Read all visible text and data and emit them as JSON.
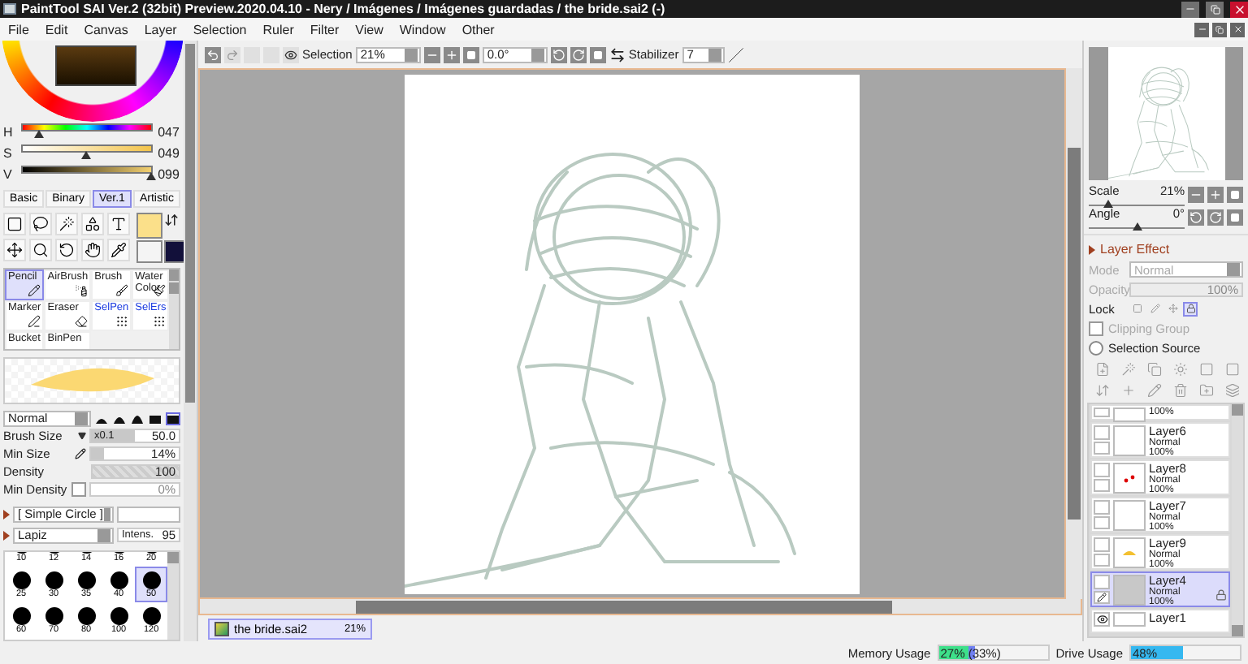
{
  "window": {
    "title": "PaintTool SAI Ver.2 (32bit) Preview.2020.04.10 - Nery / Imágenes / Imágenes guardadas / the bride.sai2 (-)"
  },
  "menu": [
    "File",
    "Edit",
    "Canvas",
    "Layer",
    "Selection",
    "Ruler",
    "Filter",
    "View",
    "Window",
    "Other"
  ],
  "color_sliders": [
    {
      "label": "H",
      "value": "047",
      "level": 0.13,
      "kind": "hue"
    },
    {
      "label": "S",
      "value": "049",
      "level": 0.49,
      "kind": "saturation"
    },
    {
      "label": "V",
      "value": "099",
      "level": 0.99,
      "kind": "value"
    }
  ],
  "palette_tabs": [
    {
      "label": "Basic",
      "selected": false
    },
    {
      "label": "Binary",
      "selected": false
    },
    {
      "label": "Ver.1",
      "selected": true
    },
    {
      "label": "Artistic",
      "selected": false
    }
  ],
  "brushes": [
    {
      "label": "Pencil",
      "kind": "paint",
      "selected": true
    },
    {
      "label": "AirBrush",
      "kind": "paint",
      "selected": false
    },
    {
      "label": "Brush",
      "kind": "paint",
      "selected": false
    },
    {
      "label": "Water Color",
      "kind": "paint",
      "selected": false
    },
    {
      "label": "Marker",
      "kind": "paint",
      "selected": false
    },
    {
      "label": "Eraser",
      "kind": "paint",
      "selected": false
    },
    {
      "label": "SelPen",
      "kind": "selection",
      "selected": false
    },
    {
      "label": "SelErs",
      "kind": "selection",
      "selected": false
    },
    {
      "label": "Bucket",
      "kind": "paint",
      "selected": false
    },
    {
      "label": "BinPen",
      "kind": "paint",
      "selected": false
    }
  ],
  "brush_settings": {
    "blend_mode": "Normal",
    "size_label": "Brush Size",
    "size_multiplier": "x0.1",
    "size": "50.0",
    "size_level": {
      "level": 0.5
    },
    "min_size_label": "Min Size",
    "min_size": "14%",
    "min_size_level": {
      "level": 0.14
    },
    "density_label": "Density",
    "density": "100",
    "density_level": {
      "level": 1
    },
    "min_density_label": "Min Density",
    "min_density": "0%",
    "min_density_checked": false,
    "shape": "[ Simple Circle ]",
    "texture": "Lapiz",
    "intensity_label": "Intens.",
    "intensity": "95"
  },
  "brush_sizes": [
    {
      "label": "10",
      "selected": false
    },
    {
      "label": "12",
      "selected": false
    },
    {
      "label": "14",
      "selected": false
    },
    {
      "label": "16",
      "selected": false
    },
    {
      "label": "20",
      "selected": false
    },
    {
      "label": "25",
      "selected": false
    },
    {
      "label": "30",
      "selected": false
    },
    {
      "label": "35",
      "selected": false
    },
    {
      "label": "40",
      "selected": false
    },
    {
      "label": "50",
      "selected": true
    },
    {
      "label": "60",
      "selected": false
    },
    {
      "label": "70",
      "selected": false
    },
    {
      "label": "80",
      "selected": false
    },
    {
      "label": "100",
      "selected": false
    },
    {
      "label": "120",
      "selected": false
    }
  ],
  "canvas_toolbar": {
    "selection_label": "Selection",
    "zoom": "21%",
    "angle": "0.0°",
    "stabilizer_label": "Stabilizer",
    "stabilizer": "7"
  },
  "navigator": [
    {
      "label": "Scale",
      "value": "21%",
      "level": 0.21
    },
    {
      "label": "Angle",
      "value": "0°",
      "level": 0.5
    }
  ],
  "layer_effect": {
    "label": "Layer Effect",
    "expanded": false
  },
  "layer_props": {
    "disabled": true,
    "mode_label": "Mode",
    "mode": "Normal",
    "opacity_label": "Opacity",
    "opacity": "100%",
    "opacity_level": {
      "level": 1
    },
    "lock_label": "Lock",
    "clipping_label": "Clipping Group",
    "clipping": false,
    "selection_source_label": "Selection Source",
    "selection_source": false
  },
  "layers": [
    {
      "kind": "cut_top",
      "opacity": "100%",
      "selected": false
    },
    {
      "kind": "full",
      "name": "Layer6",
      "mode": "Normal",
      "opacity": "100%",
      "selected": false,
      "visible": false,
      "locked": false
    },
    {
      "kind": "full",
      "name": "Layer8",
      "mode": "Normal",
      "opacity": "100%",
      "selected": false,
      "visible": false,
      "locked": false
    },
    {
      "kind": "full",
      "name": "Layer7",
      "mode": "Normal",
      "opacity": "100%",
      "selected": false,
      "visible": false,
      "locked": false
    },
    {
      "kind": "full",
      "name": "Layer9",
      "mode": "Normal",
      "opacity": "100%",
      "selected": false,
      "visible": false,
      "locked": false
    },
    {
      "kind": "full",
      "name": "Layer4",
      "mode": "Normal",
      "opacity": "100%",
      "selected": true,
      "visible": false,
      "locked": true
    },
    {
      "kind": "cut_bottom",
      "name": "Layer1",
      "selected": false,
      "visible": true
    }
  ],
  "documents": [
    {
      "name": "the bride.sai2",
      "zoom": "21%",
      "selected": true
    }
  ],
  "status": [
    {
      "label": "Memory Usage",
      "value": "27% (33%)",
      "segments": [
        {
          "level": 0.27,
          "color": "#3ee08a"
        },
        {
          "level": 0.33,
          "color": "#7080f0"
        }
      ]
    },
    {
      "label": "Drive Usage",
      "value": "48%",
      "segments": [
        {
          "level": 0.48,
          "color": "#35b8f0"
        }
      ]
    }
  ]
}
